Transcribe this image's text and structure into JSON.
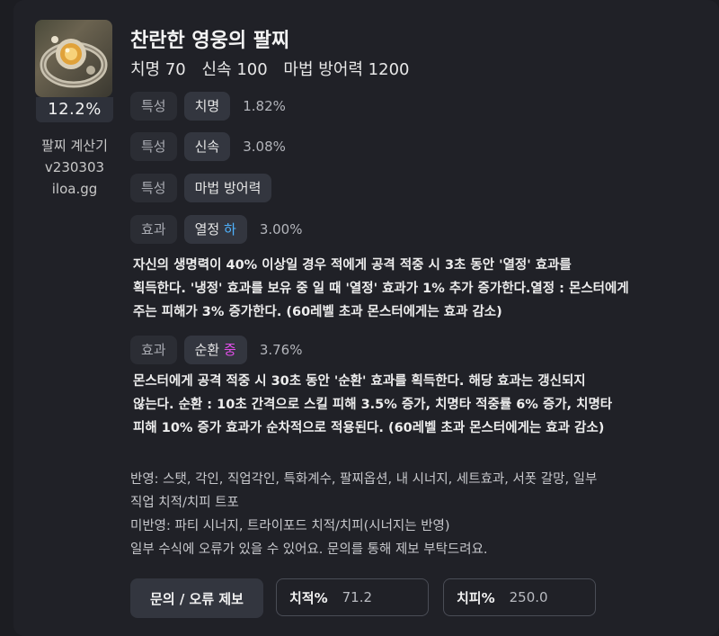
{
  "item": {
    "name": "찬란한 영웅의 팔찌",
    "stats": [
      "치명 70",
      "신속 100",
      "마법 방어력 1200"
    ],
    "percent": "12.2%",
    "icon": "bracelet-icon"
  },
  "calculator": {
    "name": "팔찌 계산기",
    "version": "v230303",
    "site": "iloa.gg"
  },
  "options": [
    {
      "type": "특성",
      "name": "치명",
      "level": "",
      "value": "1.82%"
    },
    {
      "type": "특성",
      "name": "신속",
      "level": "",
      "value": "3.08%"
    },
    {
      "type": "특성",
      "name": "마법 방어력",
      "level": "",
      "value": ""
    },
    {
      "type": "효과",
      "name": "열정",
      "level": "하",
      "value": "3.00%",
      "description": [
        "자신의 생명력이 40% 이상일 경우 적에게 공격 적중 시 3초 동안 '열정' 효과를",
        "획득한다. '냉정' 효과를 보유 중 일 때 '열정' 효과가 1% 추가 증가한다.열정 : 몬스터에게",
        "주는 피해가 3% 증가한다. (60레벨 초과 몬스터에게는 효과 감소)"
      ]
    },
    {
      "type": "효과",
      "name": "순환",
      "level": "중",
      "value": "3.76%",
      "description": [
        "몬스터에게 공격 적중 시 30초 동안 '순환' 효과를 획득한다. 해당 효과는 갱신되지",
        "않는다. 순환 : 10초 간격으로 스킬 피해 3.5% 증가, 치명타 적중률 6% 증가, 치명타",
        "피해 10% 증가 효과가 순차적으로 적용된다. (60레벨 초과 몬스터에게는 효과 감소)"
      ]
    }
  ],
  "notes": [
    "반영: 스탯, 각인, 직업각인, 특화계수, 팔찌옵션, 내 시너지, 세트효과, 서폿 갈망, 일부",
    "직업 치적/치피 트포",
    "미반영: 파티 시너지, 트라이포드 치적/치피(시너지는 반영)",
    "일부 수식에 오류가 있을 수 있어요. 문의를 통해 제보 부탁드려요."
  ],
  "footer": {
    "report_button": "문의 / 오류 제보",
    "crit_rate_label": "치적%",
    "crit_rate_value": "71.2",
    "crit_dmg_label": "치피%",
    "crit_dmg_value": "250.0"
  },
  "colors": {
    "level_low": "#4fb3ff",
    "level_mid": "#e04ee8"
  }
}
